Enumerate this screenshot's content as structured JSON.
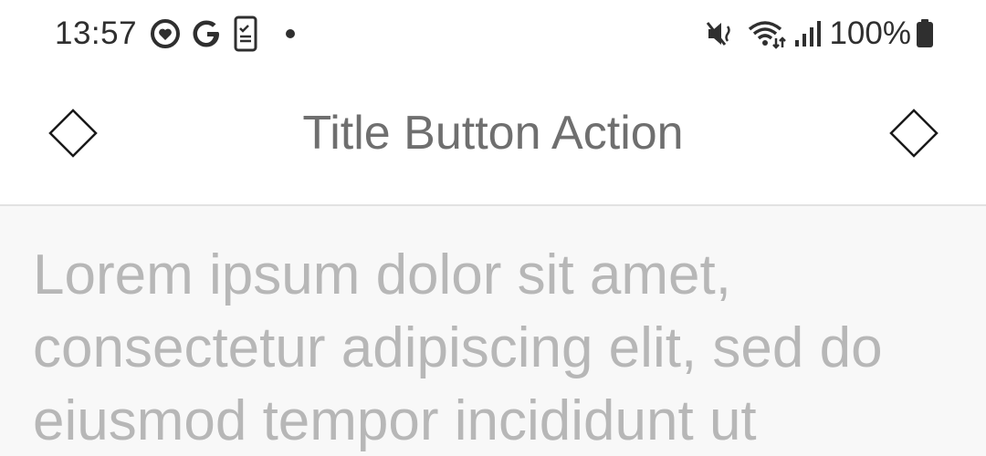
{
  "status_bar": {
    "time": "13:57",
    "battery_percent": "100%",
    "left_icons": [
      "heart-circle-icon",
      "google-icon",
      "phone-checklist-icon",
      "dot-icon"
    ],
    "right_icons": [
      "vibrate-mute-icon",
      "wifi-icon",
      "signal-icon",
      "battery-icon"
    ]
  },
  "app_bar": {
    "title": "Title Button Action",
    "left_button_icon": "diamond-icon",
    "right_button_icon": "diamond-icon"
  },
  "content": {
    "body_text": "Lorem ipsum dolor sit amet, consectetur adipiscing elit, sed do eiusmod tempor incididunt ut"
  },
  "colors": {
    "title": "#6f6f6f",
    "body_text": "#b7b7b7",
    "content_bg": "#f8f8f8",
    "status_text": "#2f2f2f"
  }
}
